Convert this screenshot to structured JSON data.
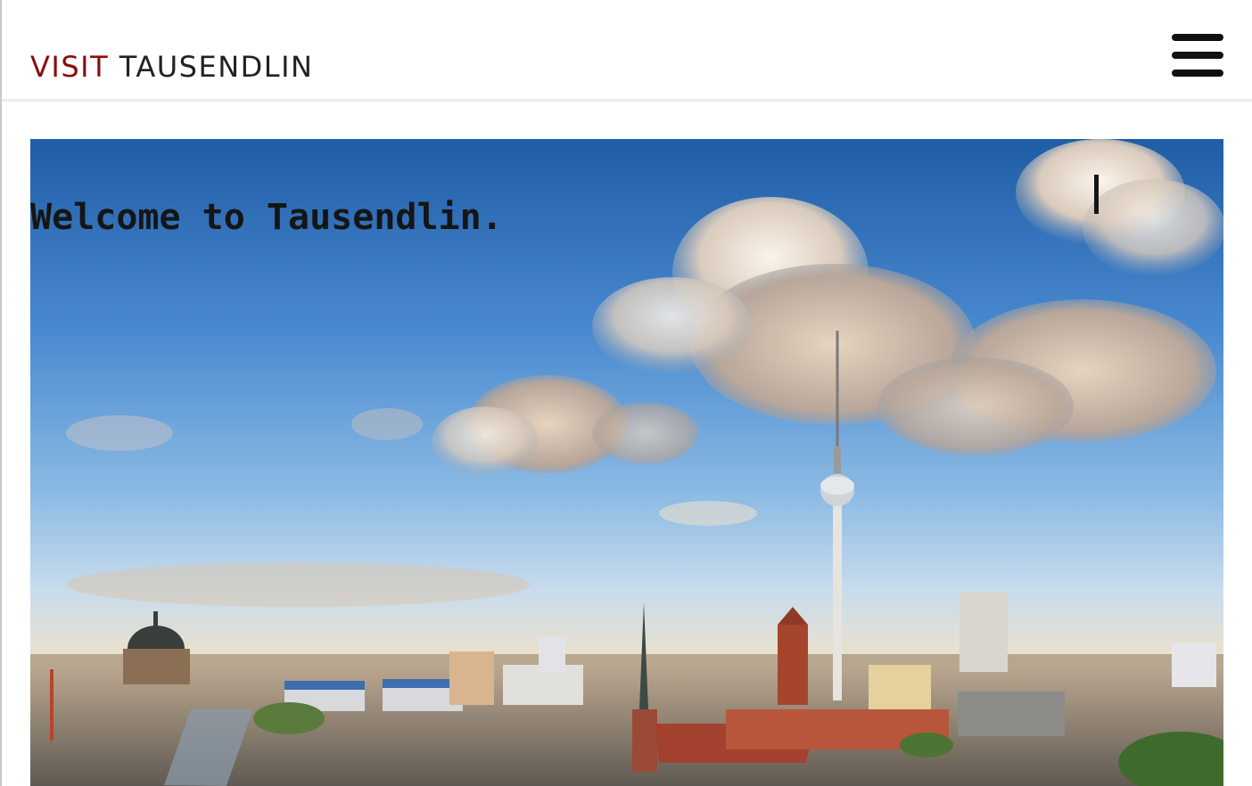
{
  "header": {
    "brand_accent": "VISIT",
    "brand_main": "TAUSENDLIN",
    "menu_icon": "hamburger-menu-icon",
    "accent_color": "#8b0d0d"
  },
  "hero": {
    "title": "Welcome to Tausendlin.",
    "image": "city-skyline-image"
  }
}
